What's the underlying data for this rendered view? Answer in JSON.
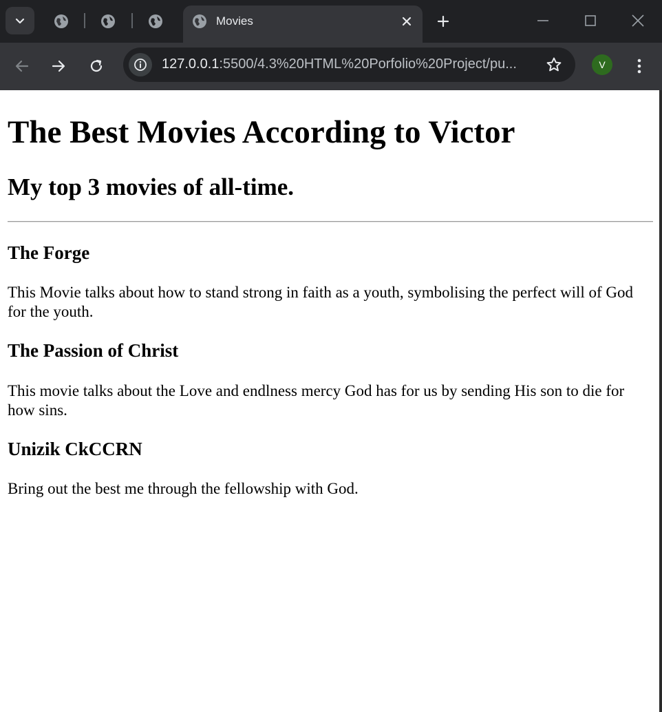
{
  "browser": {
    "active_tab_title": "Movies",
    "url_host": "127.0.0.1",
    "url_path": ":5500/4.3%20HTML%20Porfolio%20Project/pu...",
    "profile_initial": "V",
    "accent": "#2e6b1f"
  },
  "page": {
    "title": "The Best Movies According to Victor",
    "subtitle": "My top 3 movies of all-time.",
    "movies": [
      {
        "name": "The Forge",
        "description": "This Movie talks about how to stand strong in faith as a youth, symbolising the perfect will of God for the youth."
      },
      {
        "name": "The Passion of Christ",
        "description": "This movie talks about the Love and endlness mercy God has for us by sending His son to die for how sins."
      },
      {
        "name": "Unizik CkCCRN",
        "description": "Bring out the best me through the fellowship with God."
      }
    ]
  }
}
